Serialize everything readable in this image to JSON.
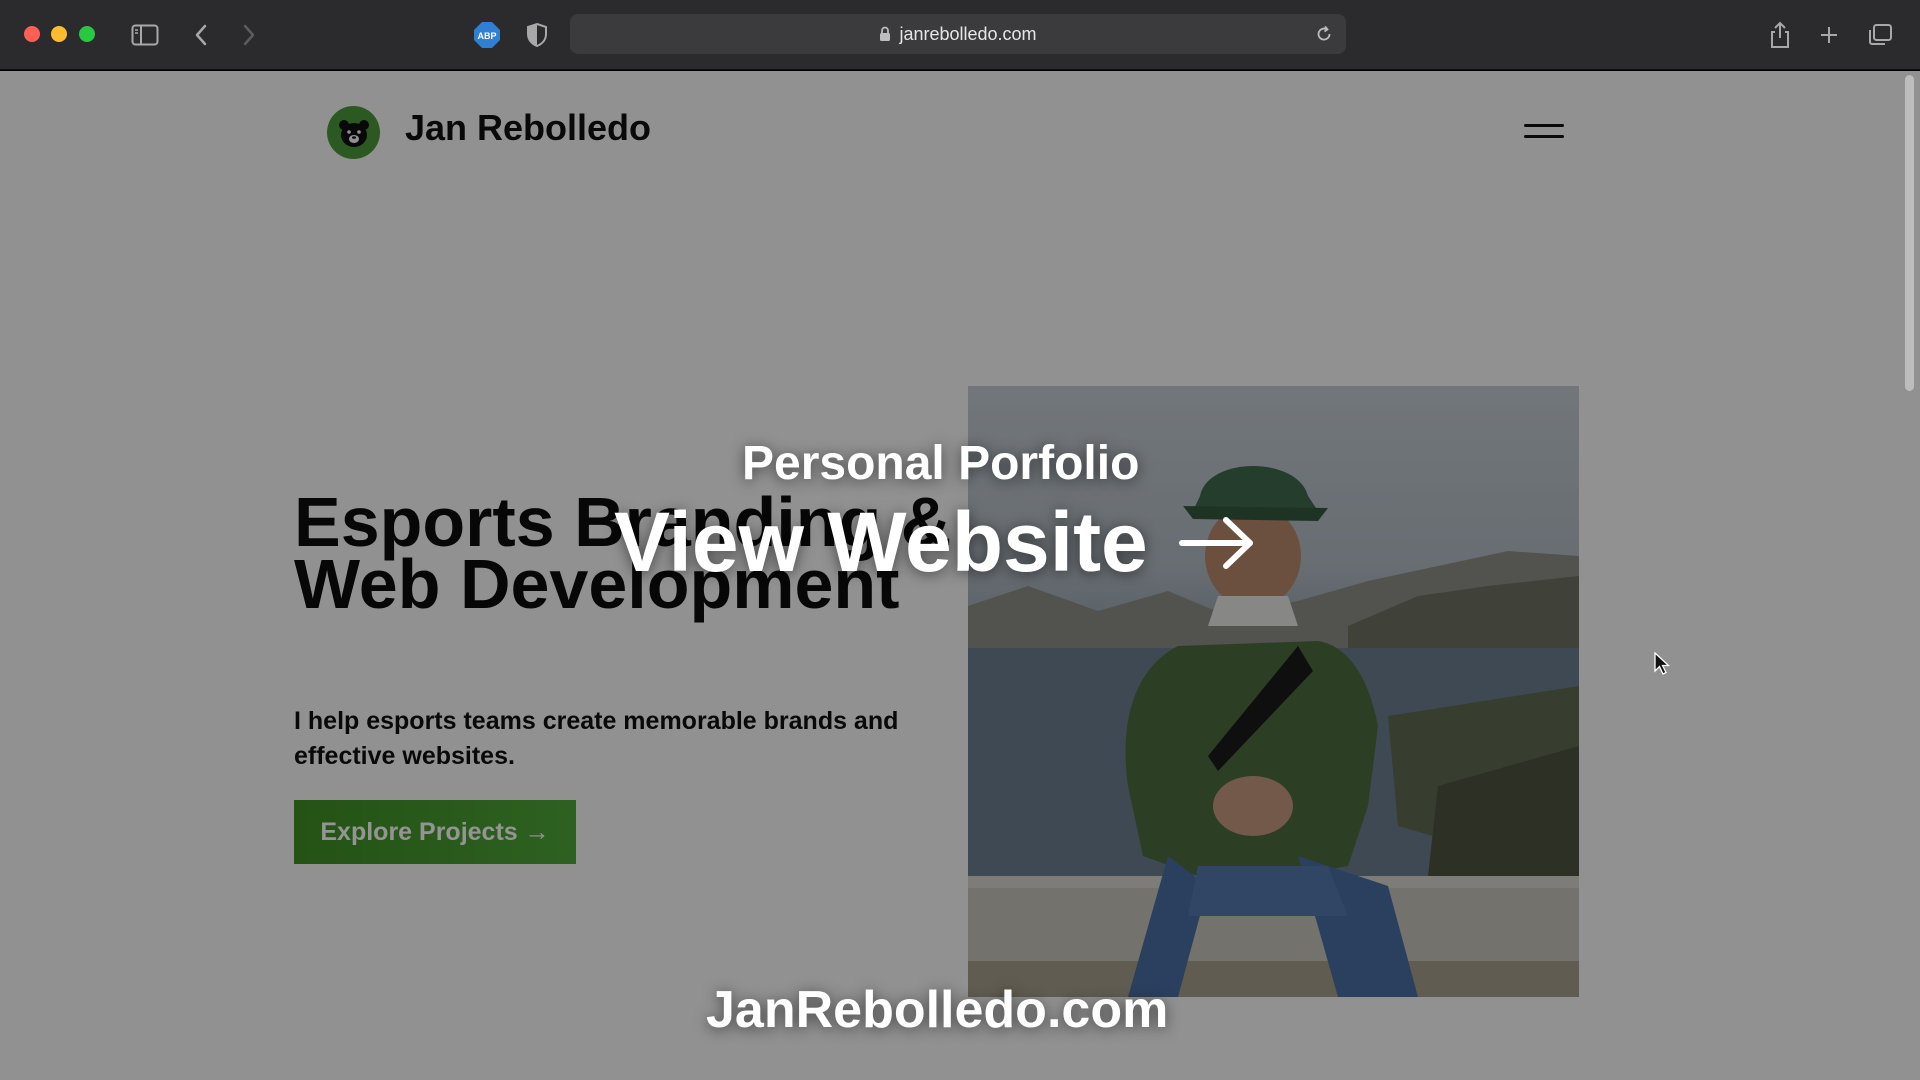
{
  "browser": {
    "url": "janrebolledo.com",
    "icons": {
      "sidebar": "sidebar-icon",
      "back": "chevron-left-icon",
      "forward": "chevron-right-icon",
      "adblock": "abp-icon",
      "privacy": "shield-icon",
      "lock": "lock-icon",
      "reload": "reload-icon",
      "share": "share-icon",
      "new_tab": "plus-icon",
      "tabs": "tabs-overview-icon"
    },
    "adblock_label": "ABP"
  },
  "site": {
    "name": "Jan Rebolledo",
    "logo": "bear-logo-icon",
    "menu_icon": "hamburger-menu-icon"
  },
  "hero": {
    "title": "Esports Branding & Web Development",
    "subtitle": "I help esports teams create memorable brands and effective websites.",
    "cta_label": "Explore Projects →"
  },
  "overlay": {
    "kicker": "Personal Porfolio",
    "main": "View Website",
    "url": "JanRebolledo.com"
  },
  "colors": {
    "accent_green": "#4a9a3a",
    "chrome_bg": "#2b2b2d"
  }
}
